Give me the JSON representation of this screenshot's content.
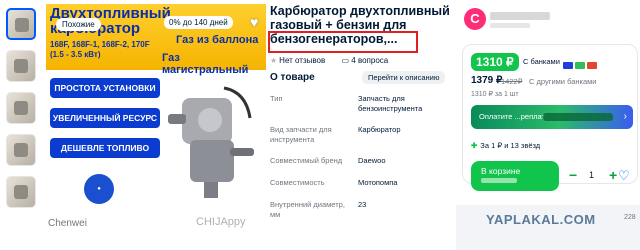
{
  "hero": {
    "title": "Двухтопливный карбюратор",
    "similar_badge": "Похожие",
    "credit_badge": "0% до 140 дней",
    "models": "168F, 168F-1, 168F-2, 170F (1.5 - 3.5 кВт)",
    "gas_line1": "Газ из баллона",
    "gas_line2": "Газ магистральный",
    "features": [
      "ПРОСТОТА УСТАНОВКИ",
      "УВЕЛИЧЕННЫЙ РЕСУРС",
      "ДЕШЕВЛЕ ТОПЛИВО"
    ],
    "watermark_left": "Chenwei",
    "watermark_right": "CHIJAppy"
  },
  "product": {
    "title_line1": "Карбюратор двухтопливный",
    "title_line2": "газовый + бензин для",
    "title_line3": "бензогенераторов,...",
    "no_reviews": "Нет отзывов",
    "questions": "4 вопроса",
    "about_label": "О товаре",
    "to_description": "Перейти к описанию",
    "specs": [
      {
        "key": "Тип",
        "value": "Запчасть для бензоинструмента"
      },
      {
        "key": "Вид запчасти для инструмента",
        "value": "Карбюратор"
      },
      {
        "key": "Совместимый бренд",
        "value": "Daewoo"
      },
      {
        "key": "Совместимость",
        "value": "Мотопомпа"
      },
      {
        "key": "Внутренний диаметр, мм",
        "value": "23"
      }
    ]
  },
  "buy": {
    "seller_logo_letter": "C",
    "price_green": "1310 ₽",
    "price_green_note": "С банками",
    "price_main": "1379 ₽",
    "price_old": "1422₽",
    "price_main_note": "С другими банками",
    "unit_price": "1310 ₽ за 1 шт",
    "promo_text": "Оплатите ...реплат",
    "bonus": "За 1 ₽ и 13 звёзд",
    "cart_label": "В корзине",
    "qty": "1",
    "minus": "−",
    "plus": "+"
  },
  "watermark": {
    "site": "YAPLAKAL.COM",
    "count": "228"
  }
}
